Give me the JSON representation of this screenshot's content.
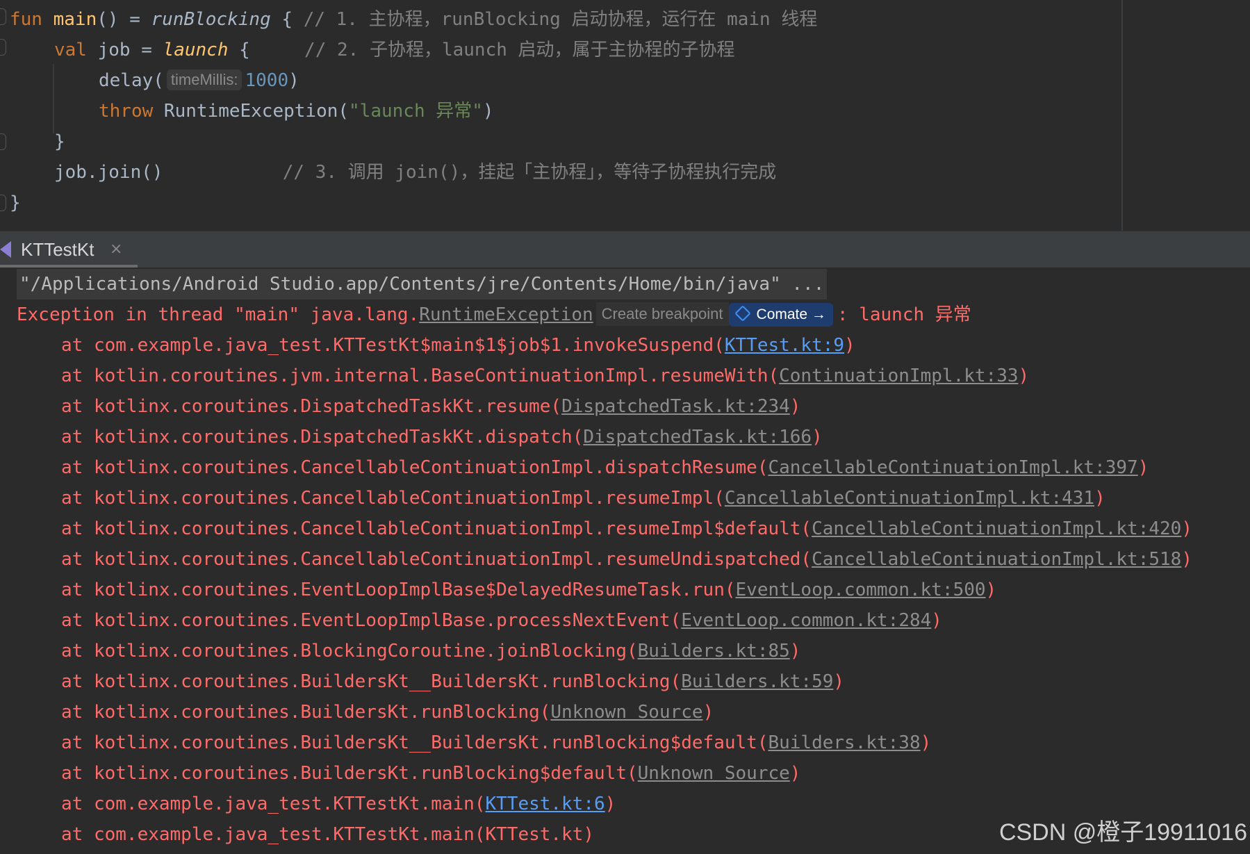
{
  "editor": {
    "lines": [
      {
        "kw": "fun ",
        "fn": "main",
        "rest1": "() = ",
        "ital": "runBlocking",
        "rest2": " { ",
        "comment": "// 1. 主协程，runBlocking 启动协程，运行在 main 线程"
      },
      {
        "kw": "val ",
        "name": "job = ",
        "ital": "launch",
        "rest": " {     ",
        "comment": "// 2. 子协程，launch 启动，属于主协程的子协程"
      },
      {
        "pre": "delay(",
        "hint": "timeMillis:",
        "num": "1000",
        "post": ")"
      },
      {
        "kw": "throw ",
        "pre": "RuntimeException(",
        "str": "\"launch 异常\"",
        "post": ")"
      },
      {
        "text": "}"
      },
      {
        "pre": "job.join()           ",
        "comment": "// 3. 调用 join()，挂起「主协程」，等待子协程执行完成"
      },
      {
        "text": "}"
      }
    ]
  },
  "tab": {
    "label": "KTTestKt",
    "close": "×"
  },
  "console": {
    "cmdline": "\"/Applications/Android Studio.app/Contents/jre/Contents/Home/bin/java\" ...",
    "exception": {
      "prefix": "Exception in thread \"main\" java.lang.",
      "class_link": "RuntimeException",
      "breakpoint_hint": "Create breakpoint",
      "comate_label": "Comate →",
      "suffix": ": launch 异常"
    },
    "trace": [
      {
        "text": "at com.example.java_test.KTTestKt$main$1$job$1.invokeSuspend(",
        "link": "KTTest.kt:9",
        "blue": true,
        "close": ")"
      },
      {
        "text": "at kotlin.coroutines.jvm.internal.BaseContinuationImpl.resumeWith(",
        "link": "ContinuationImpl.kt:33",
        "blue": false,
        "close": ")"
      },
      {
        "text": "at kotlinx.coroutines.DispatchedTaskKt.resume(",
        "link": "DispatchedTask.kt:234",
        "blue": false,
        "close": ")"
      },
      {
        "text": "at kotlinx.coroutines.DispatchedTaskKt.dispatch(",
        "link": "DispatchedTask.kt:166",
        "blue": false,
        "close": ")"
      },
      {
        "text": "at kotlinx.coroutines.CancellableContinuationImpl.dispatchResume(",
        "link": "CancellableContinuationImpl.kt:397",
        "blue": false,
        "close": ")"
      },
      {
        "text": "at kotlinx.coroutines.CancellableContinuationImpl.resumeImpl(",
        "link": "CancellableContinuationImpl.kt:431",
        "blue": false,
        "close": ")"
      },
      {
        "text": "at kotlinx.coroutines.CancellableContinuationImpl.resumeImpl$default(",
        "link": "CancellableContinuationImpl.kt:420",
        "blue": false,
        "close": ")"
      },
      {
        "text": "at kotlinx.coroutines.CancellableContinuationImpl.resumeUndispatched(",
        "link": "CancellableContinuationImpl.kt:518",
        "blue": false,
        "close": ")"
      },
      {
        "text": "at kotlinx.coroutines.EventLoopImplBase$DelayedResumeTask.run(",
        "link": "EventLoop.common.kt:500",
        "blue": false,
        "close": ")"
      },
      {
        "text": "at kotlinx.coroutines.EventLoopImplBase.processNextEvent(",
        "link": "EventLoop.common.kt:284",
        "blue": false,
        "close": ")"
      },
      {
        "text": "at kotlinx.coroutines.BlockingCoroutine.joinBlocking(",
        "link": "Builders.kt:85",
        "blue": false,
        "close": ")"
      },
      {
        "text": "at kotlinx.coroutines.BuildersKt__BuildersKt.runBlocking(",
        "link": "Builders.kt:59",
        "blue": false,
        "close": ")"
      },
      {
        "text": "at kotlinx.coroutines.BuildersKt.runBlocking(",
        "link": "Unknown Source",
        "blue": false,
        "close": ")"
      },
      {
        "text": "at kotlinx.coroutines.BuildersKt__BuildersKt.runBlocking$default(",
        "link": "Builders.kt:38",
        "blue": false,
        "close": ")"
      },
      {
        "text": "at kotlinx.coroutines.BuildersKt.runBlocking$default(",
        "link": "Unknown Source",
        "blue": false,
        "close": ")"
      },
      {
        "text": "at com.example.java_test.KTTestKt.main(",
        "link": "KTTest.kt:6",
        "blue": true,
        "close": ")"
      },
      {
        "text": "at com.example.java_test.KTTestKt.main(KTTest.kt)",
        "link": "",
        "blue": false,
        "close": ""
      }
    ]
  },
  "watermark": "CSDN @橙子19911016",
  "colors": {
    "error": "#ff6b68",
    "link_blue": "#589df6",
    "keyword": "#cc7832",
    "function": "#ffc66d",
    "comment": "#808080",
    "number": "#6897bb",
    "string": "#6a8759"
  }
}
